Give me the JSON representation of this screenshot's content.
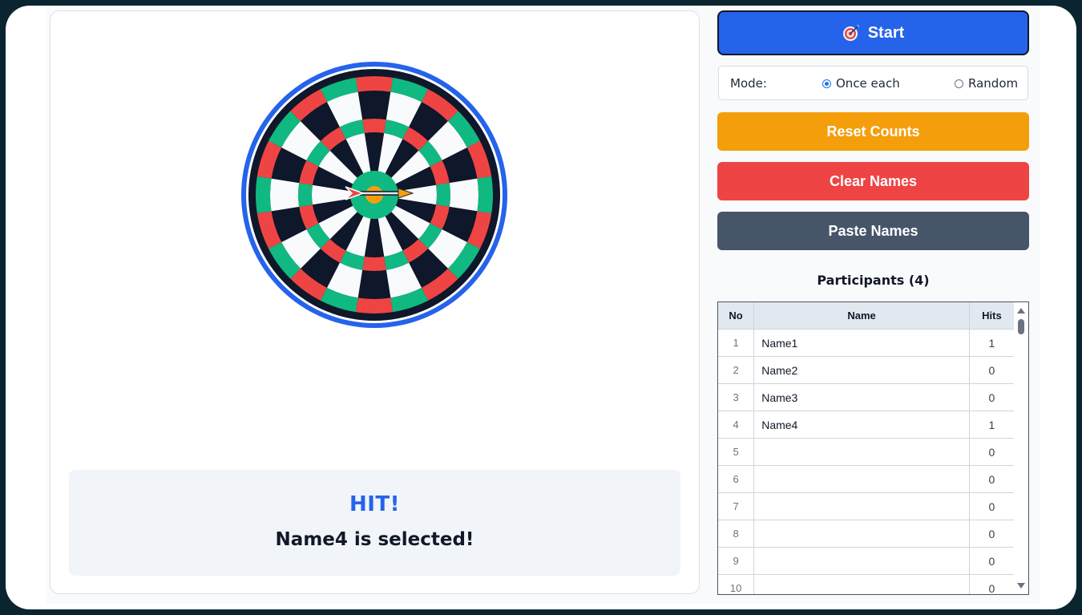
{
  "result": {
    "hit_label": "HIT!",
    "selected_message": "Name4 is selected!"
  },
  "controls": {
    "start_label": "Start",
    "mode_label": "Mode:",
    "mode_options": [
      {
        "label": "Once each",
        "selected": true
      },
      {
        "label": "Random",
        "selected": false
      }
    ],
    "reset_label": "Reset Counts",
    "clear_label": "Clear Names",
    "paste_label": "Paste Names"
  },
  "participants": {
    "title": "Participants (4)",
    "columns": [
      "No",
      "Name",
      "Hits"
    ],
    "rows": [
      {
        "no": "1",
        "name": "Name1",
        "hits": "1"
      },
      {
        "no": "2",
        "name": "Name2",
        "hits": "0"
      },
      {
        "no": "3",
        "name": "Name3",
        "hits": "0"
      },
      {
        "no": "4",
        "name": "Name4",
        "hits": "1"
      },
      {
        "no": "5",
        "name": "",
        "hits": "0"
      },
      {
        "no": "6",
        "name": "",
        "hits": "0"
      },
      {
        "no": "7",
        "name": "",
        "hits": "0"
      },
      {
        "no": "8",
        "name": "",
        "hits": "0"
      },
      {
        "no": "9",
        "name": "",
        "hits": "0"
      },
      {
        "no": "10",
        "name": "",
        "hits": "0"
      }
    ]
  },
  "colors": {
    "primary": "#2563eb",
    "reset": "#f59e0b",
    "clear": "#ef4444",
    "paste": "#475569",
    "board_dark": "#0f172a",
    "board_light": "#f8fafc",
    "ring_red": "#ef4444",
    "ring_green": "#10b981",
    "bull": "#f59e0b"
  },
  "icons": {
    "start": "target-icon",
    "dart": "dart-arrow-icon"
  }
}
